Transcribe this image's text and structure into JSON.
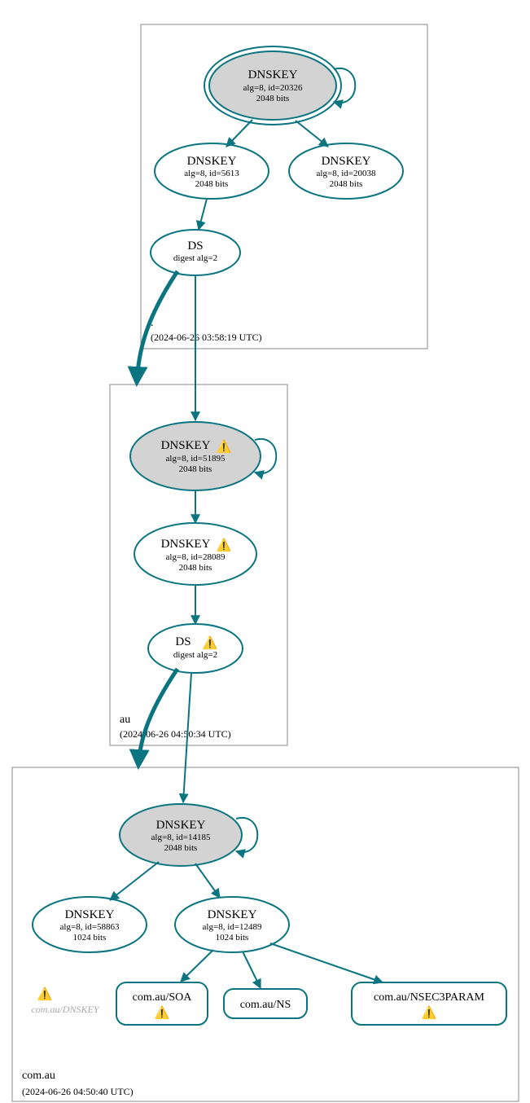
{
  "zones": {
    "root": {
      "label": ".",
      "timestamp": "(2024-06-26 03:58:19 UTC)"
    },
    "au": {
      "label": "au",
      "timestamp": "(2024-06-26 04:50:34 UTC)"
    },
    "comau": {
      "label": "com.au",
      "timestamp": "(2024-06-26 04:50:40 UTC)"
    }
  },
  "nodes": {
    "root_ksk": {
      "title": "DNSKEY",
      "line1": "alg=8, id=20326",
      "line2": "2048 bits"
    },
    "root_zsk1": {
      "title": "DNSKEY",
      "line1": "alg=8, id=5613",
      "line2": "2048 bits"
    },
    "root_zsk2": {
      "title": "DNSKEY",
      "line1": "alg=8, id=20038",
      "line2": "2048 bits"
    },
    "root_ds": {
      "title": "DS",
      "line1": "digest alg=2"
    },
    "au_ksk": {
      "title": "DNSKEY",
      "line1": "alg=8, id=51895",
      "line2": "2048 bits",
      "warning": true
    },
    "au_zsk": {
      "title": "DNSKEY",
      "line1": "alg=8, id=28089",
      "line2": "2048 bits",
      "warning": true
    },
    "au_ds": {
      "title": "DS",
      "line1": "digest alg=2",
      "warning": true
    },
    "comau_ksk": {
      "title": "DNSKEY",
      "line1": "alg=8, id=14185",
      "line2": "2048 bits"
    },
    "comau_zsk1": {
      "title": "DNSKEY",
      "line1": "alg=8, id=58863",
      "line2": "1024 bits"
    },
    "comau_zsk2": {
      "title": "DNSKEY",
      "line1": "alg=8, id=12489",
      "line2": "1024 bits"
    },
    "comau_ghost": {
      "label": "com.au/DNSKEY",
      "warning": true
    }
  },
  "rrsets": {
    "soa": {
      "label": "com.au/SOA",
      "warning": true
    },
    "ns": {
      "label": "com.au/NS"
    },
    "nsec3param": {
      "label": "com.au/NSEC3PARAM",
      "warning": true
    }
  },
  "icons": {
    "warning": "⚠️"
  }
}
